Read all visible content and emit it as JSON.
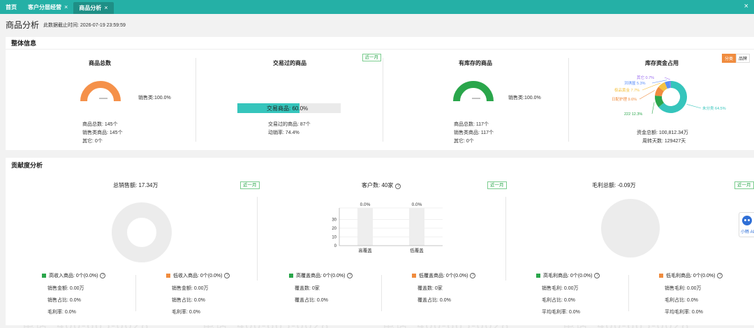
{
  "tabs": [
    {
      "label": "首页",
      "closable": false,
      "active": false
    },
    {
      "label": "客户分层经营",
      "closable": true,
      "active": false
    },
    {
      "label": "商品分析",
      "closable": true,
      "active": true
    }
  ],
  "close_all": "×",
  "close_tab": "×",
  "page": {
    "title": "商品分析",
    "deadline": "此数据截止时间: 2026-07-19 23:59:59"
  },
  "overall": {
    "title": "整体信息",
    "total": {
      "title": "商品总数",
      "legend": "销售类:100.0%",
      "gauge_fraction": 1.0,
      "lines": [
        "商品总数: 145个",
        "销售类商品: 145个",
        "其它: 0个"
      ]
    },
    "traded": {
      "title": "交易过的商品",
      "badge": "近一月",
      "progress_label": "交易商品: 60.0%",
      "progress_fraction": 0.6,
      "lines": [
        "交易过的商品: 87个",
        "动销率: 74.4%"
      ]
    },
    "instock": {
      "title": "有库存的商品",
      "legend": "销售类:100.0%",
      "gauge_fraction": 1.0,
      "lines": [
        "商品总数: 117个",
        "销售类商品: 117个",
        "其它: 0个"
      ]
    },
    "capital": {
      "title": "库存资金占用",
      "toggle": [
        "分类",
        "品牌"
      ],
      "slices": [
        {
          "label": "未分类 64.5%",
          "value": 64.5,
          "color": "#36c5bc"
        },
        {
          "label": "222 12.3%",
          "value": 12.3,
          "color": "#2aa64b"
        },
        {
          "label": "日配护理 9.6%",
          "value": 9.6,
          "color": "#f08c3f"
        },
        {
          "label": "极品黄金 7.7%",
          "value": 7.7,
          "color": "#f5c242"
        },
        {
          "label": "洪琪屋 5.3%",
          "value": 5.3,
          "color": "#5b8ff9"
        },
        {
          "label": "其它 0.7%",
          "value": 0.7,
          "color": "#9b6cf0"
        }
      ],
      "lines": [
        "资金总额: 100,812.34万",
        "周转天数: 129427天"
      ]
    }
  },
  "contrib": {
    "title": "贡献度分析",
    "badge": "近一月",
    "sales": {
      "head": "总销售额: 17.34万",
      "groups": [
        {
          "legend": "高收入商品: 0个(0.0%)",
          "color": "#2aa64b",
          "stats": [
            "销售金额: 0.00万",
            "销售占比: 0.0%",
            "毛利率: 0.0%"
          ]
        },
        {
          "legend": "低收入商品: 0个(0.0%)",
          "color": "#f08c3f",
          "stats": [
            "销售金额: 0.00万",
            "销售占比: 0.0%",
            "毛利率: 0.0%"
          ]
        }
      ]
    },
    "customers": {
      "head": "客户数: 40家",
      "chart_data": {
        "type": "bar",
        "categories": [
          "高覆盖",
          "低覆盖"
        ],
        "values": [
          0,
          0
        ],
        "data_labels": [
          "0.0%",
          "0.0%"
        ],
        "yticks": [
          "0",
          "10",
          "20",
          "30"
        ],
        "ylim": [
          0,
          40
        ]
      },
      "groups": [
        {
          "legend": "高覆盖商品: 0个(0.0%)",
          "color": "#2aa64b",
          "stats": [
            "覆盖数: 0家",
            "覆盖占比: 0.0%"
          ]
        },
        {
          "legend": "低覆盖商品: 0个(0.0%)",
          "color": "#f08c3f",
          "stats": [
            "覆盖数: 0家",
            "覆盖占比: 0.0%"
          ]
        }
      ]
    },
    "profit": {
      "head": "毛利总额: -0.09万",
      "groups": [
        {
          "legend": "高毛利商品: 0个(0.0%)",
          "color": "#2aa64b",
          "stats": [
            "销售毛利: 0.00万",
            "毛利占比: 0.0%",
            "平均毛利率: 0.0%"
          ]
        },
        {
          "legend": "低毛利商品: 0个(0.0%)",
          "color": "#f08c3f",
          "stats": [
            "销售毛利: 0.00万",
            "毛利占比: 0.0%",
            "平均毛利率: 0.0%"
          ]
        }
      ]
    }
  },
  "help_icon": "?",
  "assistant_label": "小畅 AI",
  "watermark": {
    "phone": "电话: 400-665-0028",
    "site": "网址: www.chanjet.net"
  },
  "colors": {
    "accent": "#25b0a6",
    "green": "#2aa64b",
    "orange": "#f08c3f",
    "gauge_orange": "#f5914a"
  }
}
